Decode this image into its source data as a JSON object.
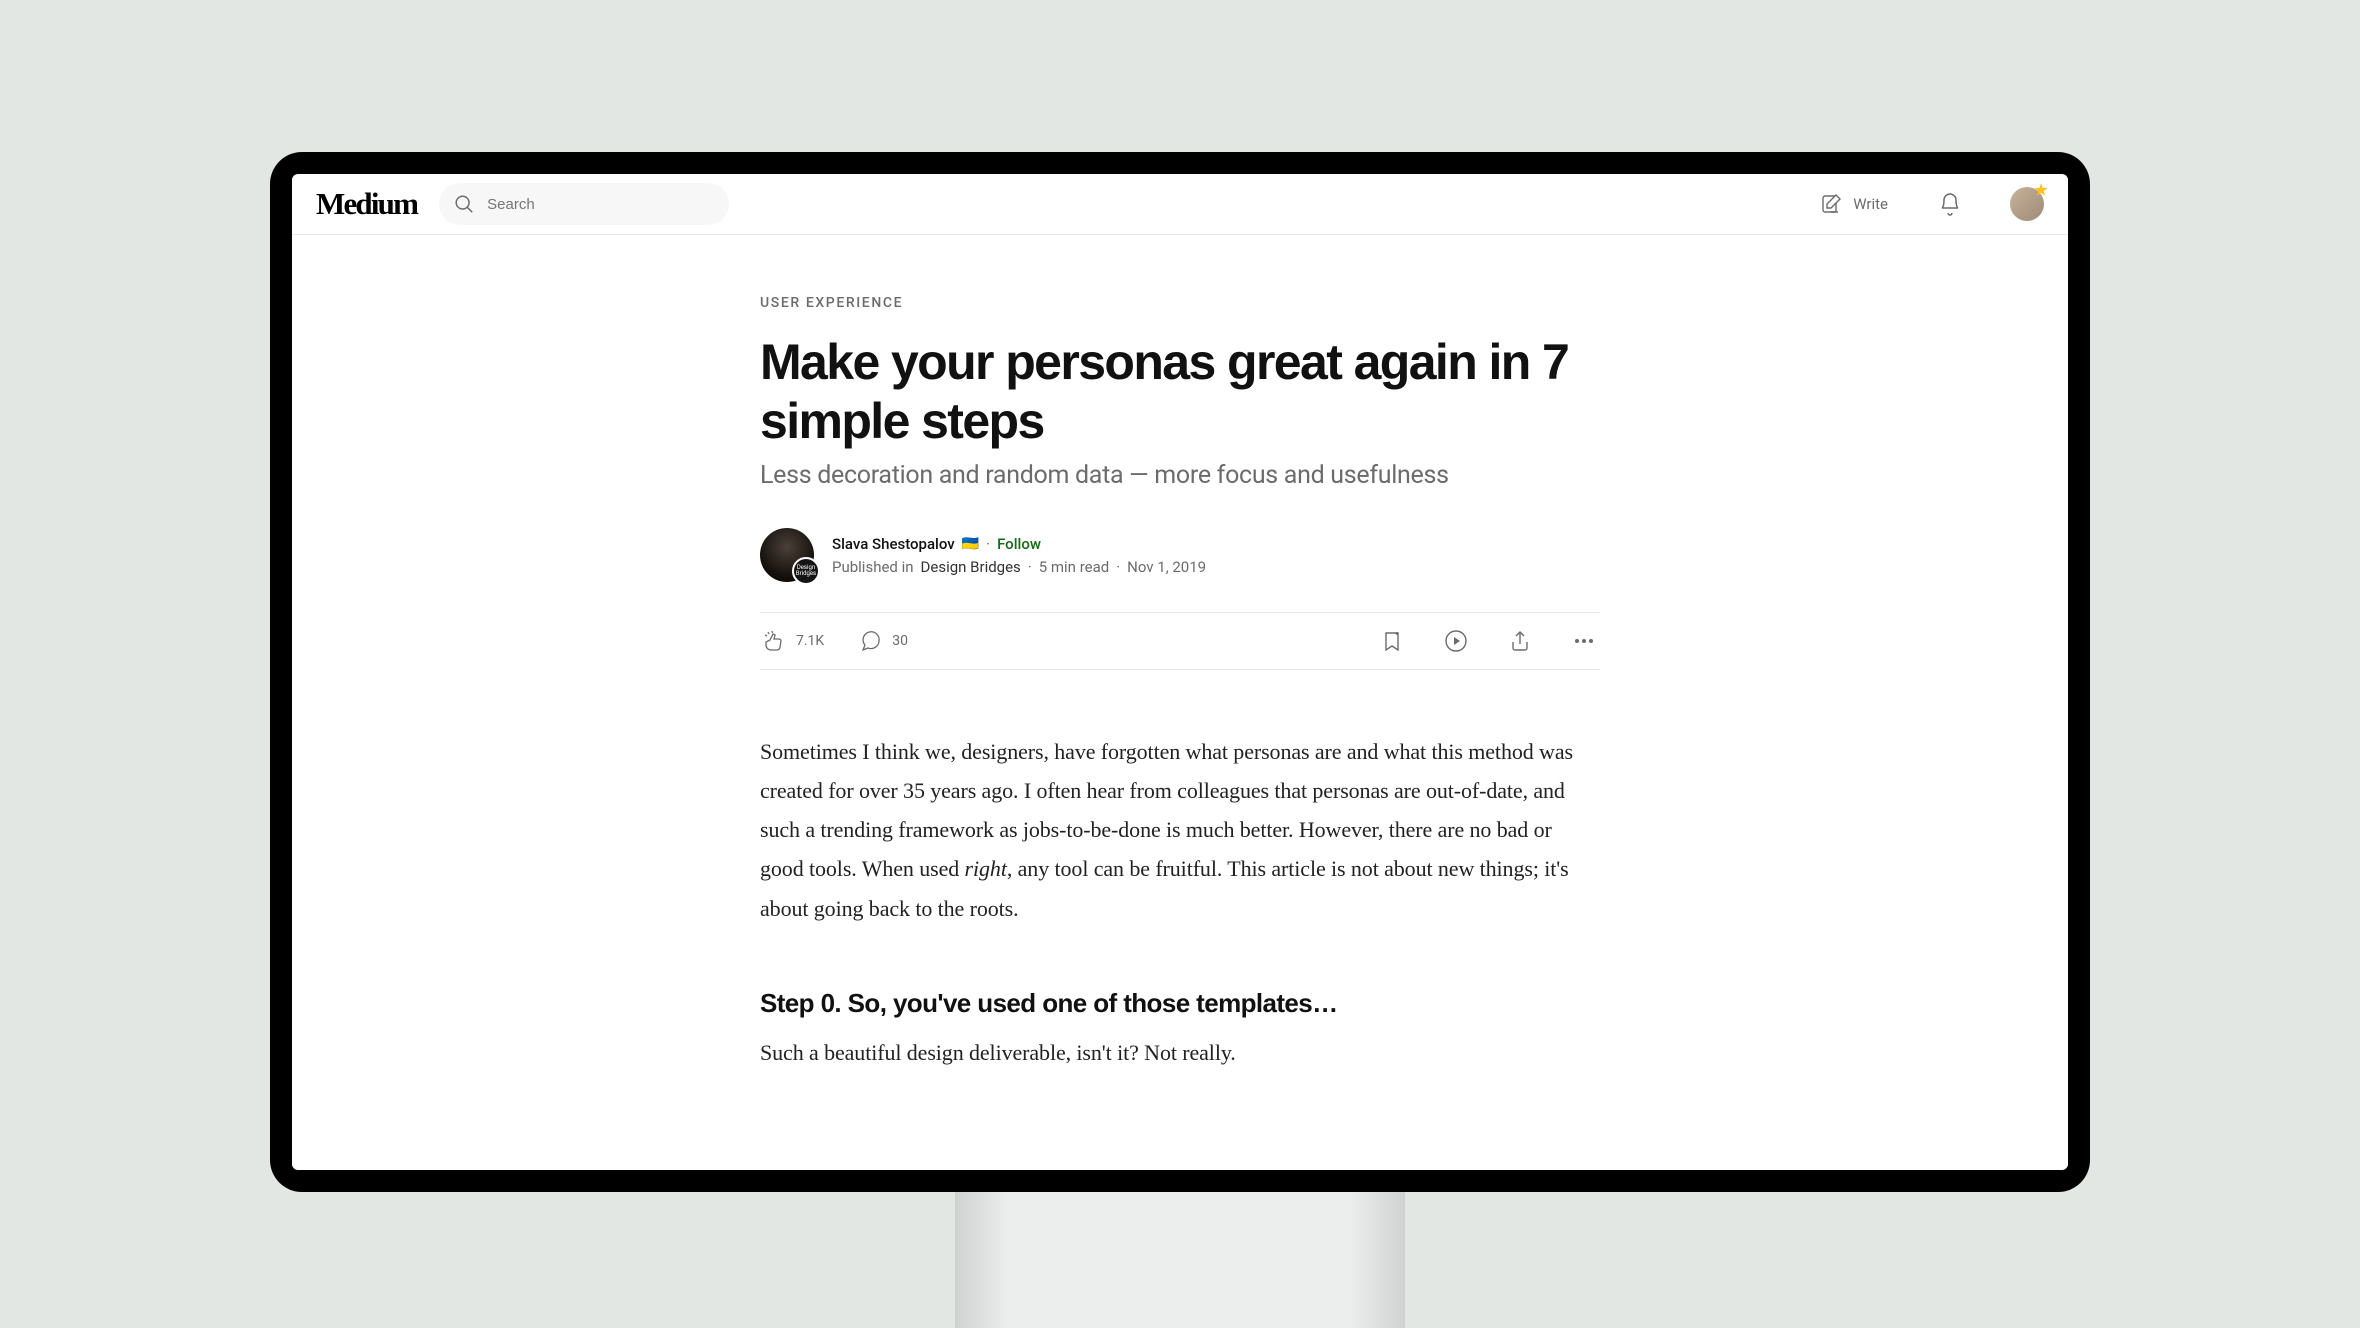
{
  "nav": {
    "logo": "Medium",
    "search_placeholder": "Search",
    "write_label": "Write"
  },
  "article": {
    "kicker": "USER EXPERIENCE",
    "title": "Make your personas great again in 7 simple steps",
    "subtitle": "Less decoration and random data — more focus and usefulness",
    "author": "Slava Shestopalov",
    "author_flag": "🇺🇦",
    "follow": "Follow",
    "published_prefix": "Published in",
    "publication": "Design Bridges",
    "read_time": "5 min read",
    "date": "Nov 1, 2019",
    "claps": "7.1K",
    "responses": "30",
    "p1a": "Sometimes I think we, designers, have forgotten what personas are and what this method was created for over 35 years ago. I often hear from colleagues that personas are out-of-date, and such a trending framework as jobs-to-be-done is much better. However, there are no bad or good tools. When used ",
    "p1b": "right",
    "p1c": ", any tool can be fruitful. This article is not about new things; it's about going back to the roots.",
    "step0_h": "Step 0. So, you've used one of those templates…",
    "step0_p": "Such a beautiful design deliverable, isn't it? Not really."
  }
}
